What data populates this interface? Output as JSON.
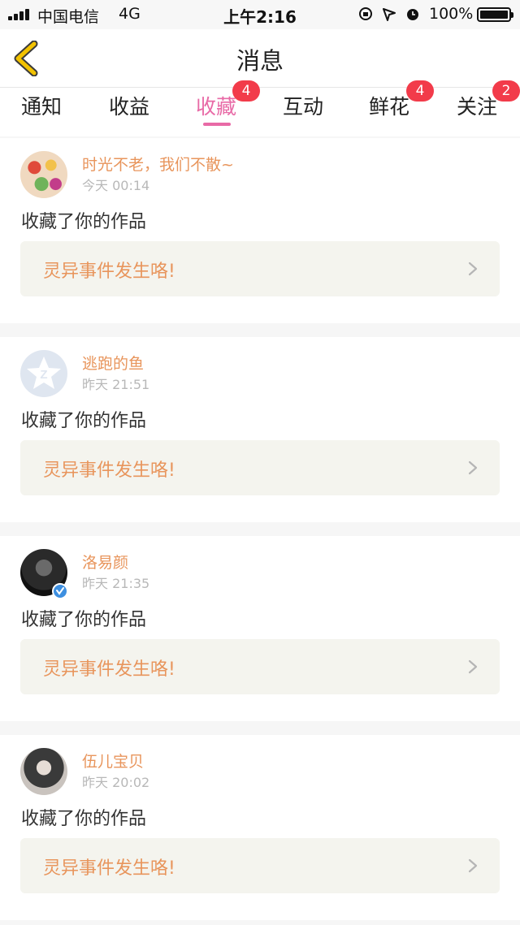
{
  "status_bar": {
    "carrier": "中国电信",
    "network": "4G",
    "time": "上午2:16",
    "battery_percent": "100%",
    "icons": [
      "orientation-lock-icon",
      "location-icon",
      "alarm-icon"
    ]
  },
  "nav": {
    "title": "消息",
    "back_icon": "chevron-left-icon"
  },
  "tabs": [
    {
      "label": "通知",
      "badge": null,
      "active": false
    },
    {
      "label": "收益",
      "badge": null,
      "active": false
    },
    {
      "label": "收藏",
      "badge": "4",
      "active": true
    },
    {
      "label": "互动",
      "badge": null,
      "active": false
    },
    {
      "label": "鲜花",
      "badge": "4",
      "active": false
    },
    {
      "label": "关注",
      "badge": "2",
      "active": false
    }
  ],
  "messages": [
    {
      "username": "时光不老，我们不散~",
      "time": "今天 00:14",
      "action": "收藏了你的作品",
      "work_title": "灵异事件发生咯!"
    },
    {
      "username": "逃跑的鱼",
      "time": "昨天 21:51",
      "action": "收藏了你的作品",
      "work_title": "灵异事件发生咯!"
    },
    {
      "username": "洛易颜",
      "time": "昨天 21:35",
      "action": "收藏了你的作品",
      "work_title": "灵异事件发生咯!"
    },
    {
      "username": "伍儿宝贝",
      "time": "昨天 20:02",
      "action": "收藏了你的作品",
      "work_title": "灵异事件发生咯!"
    }
  ],
  "colors": {
    "accent_pink": "#e86aa6",
    "username_orange": "#e8955c",
    "badge_red": "#f23b4a",
    "back_arrow_yellow": "#f2c200",
    "card_link_bg": "#f4f4ee"
  }
}
